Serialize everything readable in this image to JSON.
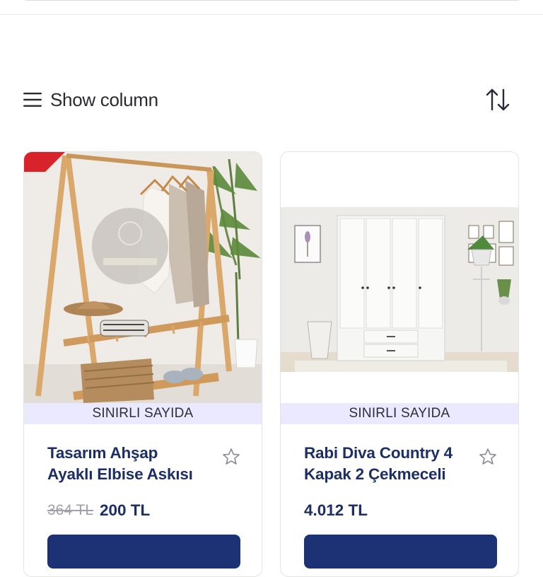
{
  "toolbar": {
    "show_column_label": "Show column",
    "menu_icon": "hamburger-icon",
    "sort_icon": "sort-arrows-icon"
  },
  "products": [
    {
      "badge": "SINIRLI SAYIDA",
      "title": "Tasarım Ahşap Ayaklı Elbise Askısı",
      "old_price": "364 TL",
      "price": "200 TL",
      "favorite_icon": "star-outline-icon",
      "image_icon": "wooden-clothes-rack-photo"
    },
    {
      "badge": "SINIRLI SAYIDA",
      "title": "Rabi Diva Country 4 Kapak 2 Çekmeceli",
      "price": "4.012 TL",
      "favorite_icon": "star-outline-icon",
      "image_icon": "white-wardrobe-photo"
    }
  ],
  "colors": {
    "accent": "#1d3275",
    "title": "#1c2e66",
    "badge_bg": "#eae9ff",
    "ribbon": "#d8232a"
  }
}
